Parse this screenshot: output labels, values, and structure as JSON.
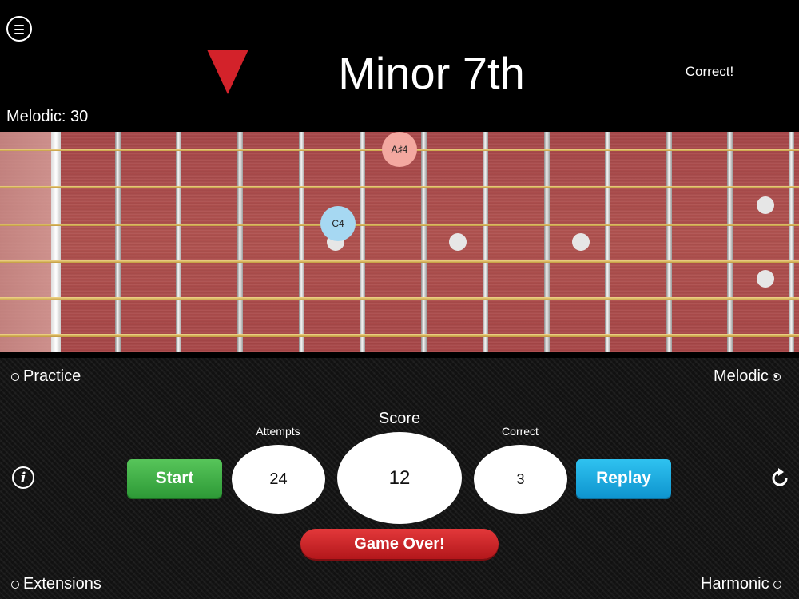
{
  "header": {
    "interval_title": "Minor 7th",
    "feedback": "Correct!",
    "mode_score": "Melodic: 30",
    "colors": {
      "arrow": "#d3222a"
    }
  },
  "fretboard": {
    "notes": [
      {
        "label": "A♯4",
        "color": "#f3a8a0"
      },
      {
        "label": "C4",
        "color": "#a6d8f2"
      }
    ]
  },
  "options": {
    "practice": {
      "label": "Practice",
      "selected": false
    },
    "melodic": {
      "label": "Melodic",
      "selected": true
    },
    "extensions": {
      "label": "Extensions",
      "selected": false
    },
    "harmonic": {
      "label": "Harmonic",
      "selected": false
    }
  },
  "stats": {
    "attempts_label": "Attempts",
    "attempts_value": "24",
    "score_label": "Score",
    "score_value": "12",
    "correct_label": "Correct",
    "correct_value": "3"
  },
  "buttons": {
    "start": "Start",
    "replay": "Replay",
    "game_over": "Game Over!"
  },
  "icons": {
    "menu": "menu-icon",
    "info": "info-icon",
    "reset": "refresh-icon",
    "indicator": "down-triangle-icon"
  }
}
